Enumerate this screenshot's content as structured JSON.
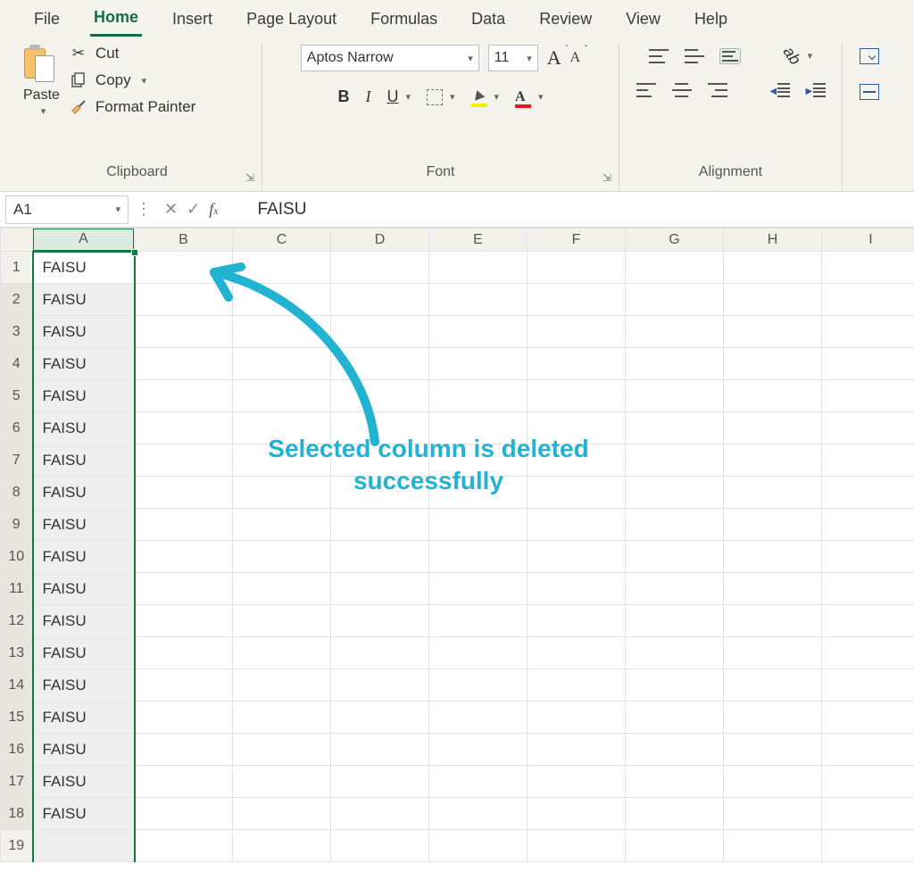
{
  "menu": {
    "tabs": [
      "File",
      "Home",
      "Insert",
      "Page Layout",
      "Formulas",
      "Data",
      "Review",
      "View",
      "Help"
    ],
    "active": "Home"
  },
  "ribbon": {
    "clipboard": {
      "label": "Clipboard",
      "paste": "Paste",
      "cut": "Cut",
      "copy": "Copy",
      "format_painter": "Format Painter"
    },
    "font": {
      "label": "Font",
      "name": "Aptos Narrow",
      "size": "11",
      "bold": "B",
      "italic": "I",
      "underline": "U"
    },
    "alignment": {
      "label": "Alignment"
    }
  },
  "formula_bar": {
    "name_box": "A1",
    "formula": "FAISU"
  },
  "grid": {
    "columns": [
      "A",
      "B",
      "C",
      "D",
      "E",
      "F",
      "G",
      "H",
      "I"
    ],
    "rows": [
      1,
      2,
      3,
      4,
      5,
      6,
      7,
      8,
      9,
      10,
      11,
      12,
      13,
      14,
      15,
      16,
      17,
      18,
      19
    ],
    "colA_values": [
      "FAISU",
      "FAISU",
      "FAISU",
      "FAISU",
      "FAISU",
      "FAISU",
      "FAISU",
      "FAISU",
      "FAISU",
      "FAISU",
      "FAISU",
      "FAISU",
      "FAISU",
      "FAISU",
      "FAISU",
      "FAISU",
      "FAISU",
      "FAISU",
      ""
    ]
  },
  "annotation": {
    "text": "Selected column is deleted successfully"
  }
}
